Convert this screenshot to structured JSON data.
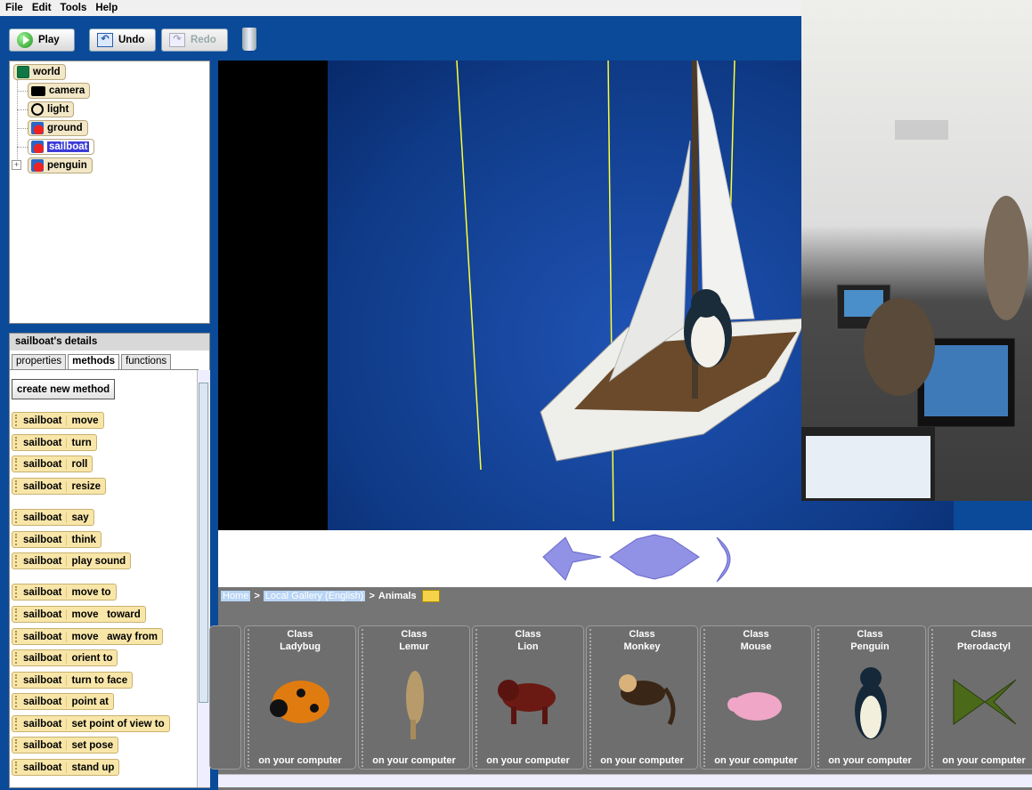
{
  "menu": [
    "File",
    "Edit",
    "Tools",
    "Help"
  ],
  "toolbar": {
    "play": "Play",
    "undo": "Undo",
    "redo": "Redo"
  },
  "scene_tree": {
    "world": "world",
    "items": [
      {
        "label": "camera",
        "icon": "camera-icon"
      },
      {
        "label": "light",
        "icon": "light-bulb-icon"
      },
      {
        "label": "ground",
        "icon": "object-icon"
      },
      {
        "label": "sailboat",
        "icon": "object-icon",
        "selected": true
      },
      {
        "label": "penguin",
        "icon": "object-icon",
        "expandable": true
      }
    ]
  },
  "details": {
    "title": "sailboat's details",
    "tabs": [
      "properties",
      "methods",
      "functions"
    ],
    "active_tab": "methods",
    "create_method": "create new method",
    "object": "sailboat",
    "methods": [
      "move",
      "turn",
      "roll",
      "resize",
      "say",
      "think",
      "play sound",
      "move to",
      "move   toward",
      "move   away from",
      "orient to",
      "turn to face",
      "point at",
      "set point of view to",
      "set pose",
      "stand up"
    ]
  },
  "gallery": {
    "crumbs": [
      "Home",
      "Local Gallery (English)",
      "Animals"
    ],
    "separator": ">",
    "class_word": "Class",
    "location": "on your computer",
    "items": [
      "Ladybug",
      "Lemur",
      "Lion",
      "Monkey",
      "Mouse",
      "Penguin",
      "Pterodactyl"
    ]
  },
  "colors": {
    "toolbar": "#0b4a98",
    "selected": "#3b3bd9",
    "tile": "#f8e6a9",
    "gallery": "#757575"
  }
}
